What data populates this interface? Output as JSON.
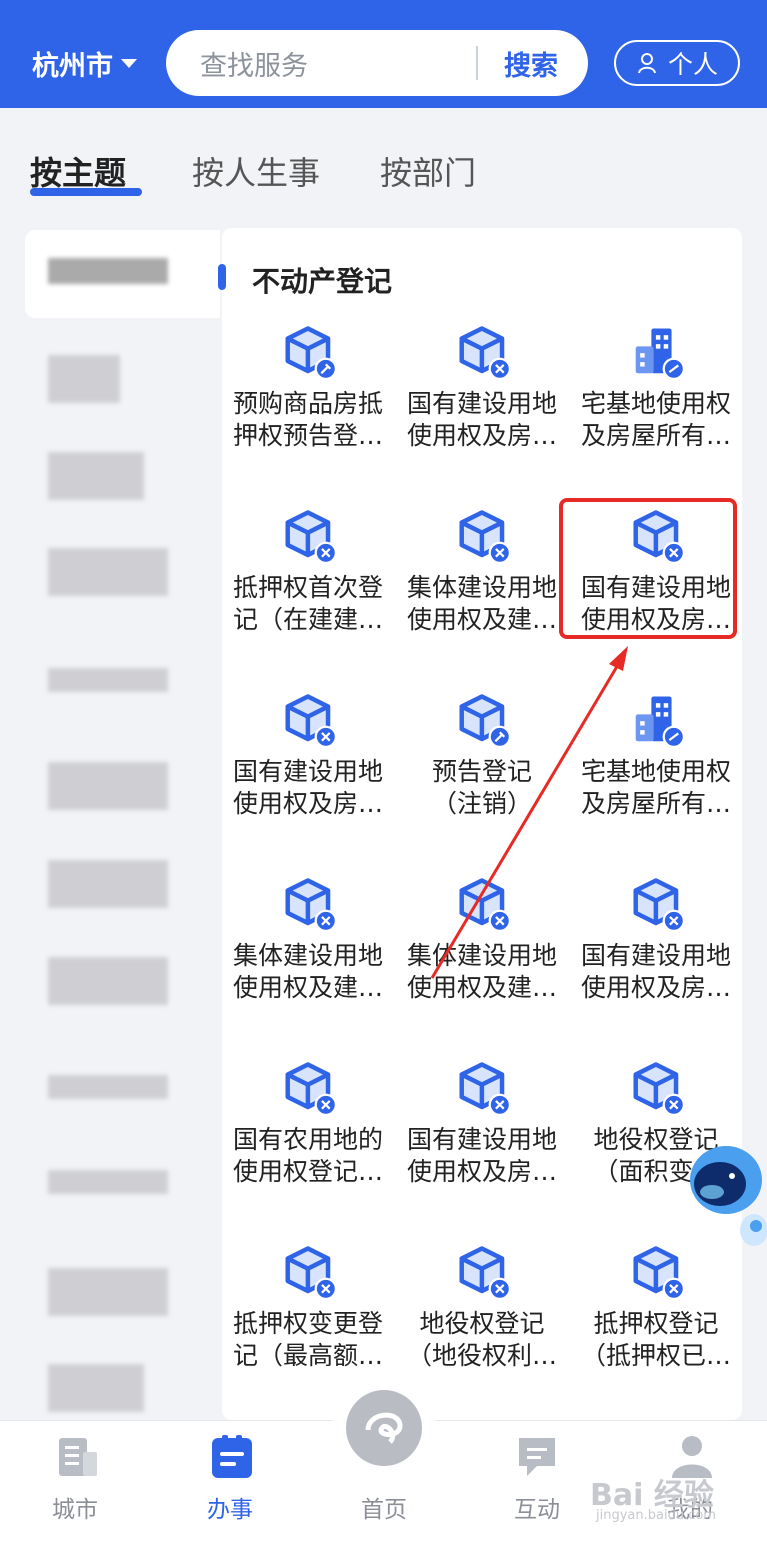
{
  "header": {
    "city": "杭州市",
    "search_placeholder": "查找服务",
    "search_button": "搜索",
    "personal": "个人"
  },
  "tabs": [
    "按主题",
    "按人生事",
    "按部门"
  ],
  "section": {
    "title": "不动产登记"
  },
  "items": [
    {
      "icon": "box-key-icon",
      "line1": "预购商品房抵",
      "line2": "押权预告登…"
    },
    {
      "icon": "box-x-icon",
      "line1": "国有建设用地",
      "line2": "使用权及房…"
    },
    {
      "icon": "building-icon",
      "line1": "宅基地使用权",
      "line2": "及房屋所有…"
    },
    {
      "icon": "box-x-icon",
      "line1": "抵押权首次登",
      "line2": "记（在建建…"
    },
    {
      "icon": "box-x-icon",
      "line1": "集体建设用地",
      "line2": "使用权及建…"
    },
    {
      "icon": "box-x-icon",
      "line1": "国有建设用地",
      "line2": "使用权及房…"
    },
    {
      "icon": "box-x-icon",
      "line1": "国有建设用地",
      "line2": "使用权及房…"
    },
    {
      "icon": "box-key-icon",
      "line1": "预告登记",
      "line2": "（注销）"
    },
    {
      "icon": "building-icon",
      "line1": "宅基地使用权",
      "line2": "及房屋所有…"
    },
    {
      "icon": "box-x-icon",
      "line1": "集体建设用地",
      "line2": "使用权及建…"
    },
    {
      "icon": "box-x-icon",
      "line1": "集体建设用地",
      "line2": "使用权及建…"
    },
    {
      "icon": "box-x-icon",
      "line1": "国有建设用地",
      "line2": "使用权及房…"
    },
    {
      "icon": "box-x-icon",
      "line1": "国有农用地的",
      "line2": "使用权登记…"
    },
    {
      "icon": "box-x-icon",
      "line1": "国有建设用地",
      "line2": "使用权及房…"
    },
    {
      "icon": "box-x-icon",
      "line1": "地役权登记",
      "line2": "（面积变…"
    },
    {
      "icon": "box-x-icon",
      "line1": "抵押权变更登",
      "line2": "记（最高额…"
    },
    {
      "icon": "box-x-icon",
      "line1": "地役权登记",
      "line2": "（地役权利…"
    },
    {
      "icon": "box-x-icon",
      "line1": "抵押权登记",
      "line2": "（抵押权已…"
    }
  ],
  "bottom_nav": [
    {
      "label": "城市",
      "icon": "city-icon"
    },
    {
      "label": "办事",
      "icon": "task-icon"
    },
    {
      "label": "首页",
      "icon": "home-icon"
    },
    {
      "label": "互动",
      "icon": "chat-icon"
    },
    {
      "label": "我的",
      "icon": "user-icon"
    }
  ],
  "watermark": {
    "brand": "Bai 经验",
    "url": "jingyan.baidu.com"
  },
  "colors": {
    "accent": "#2f63e8",
    "highlight": "#e62b26"
  }
}
